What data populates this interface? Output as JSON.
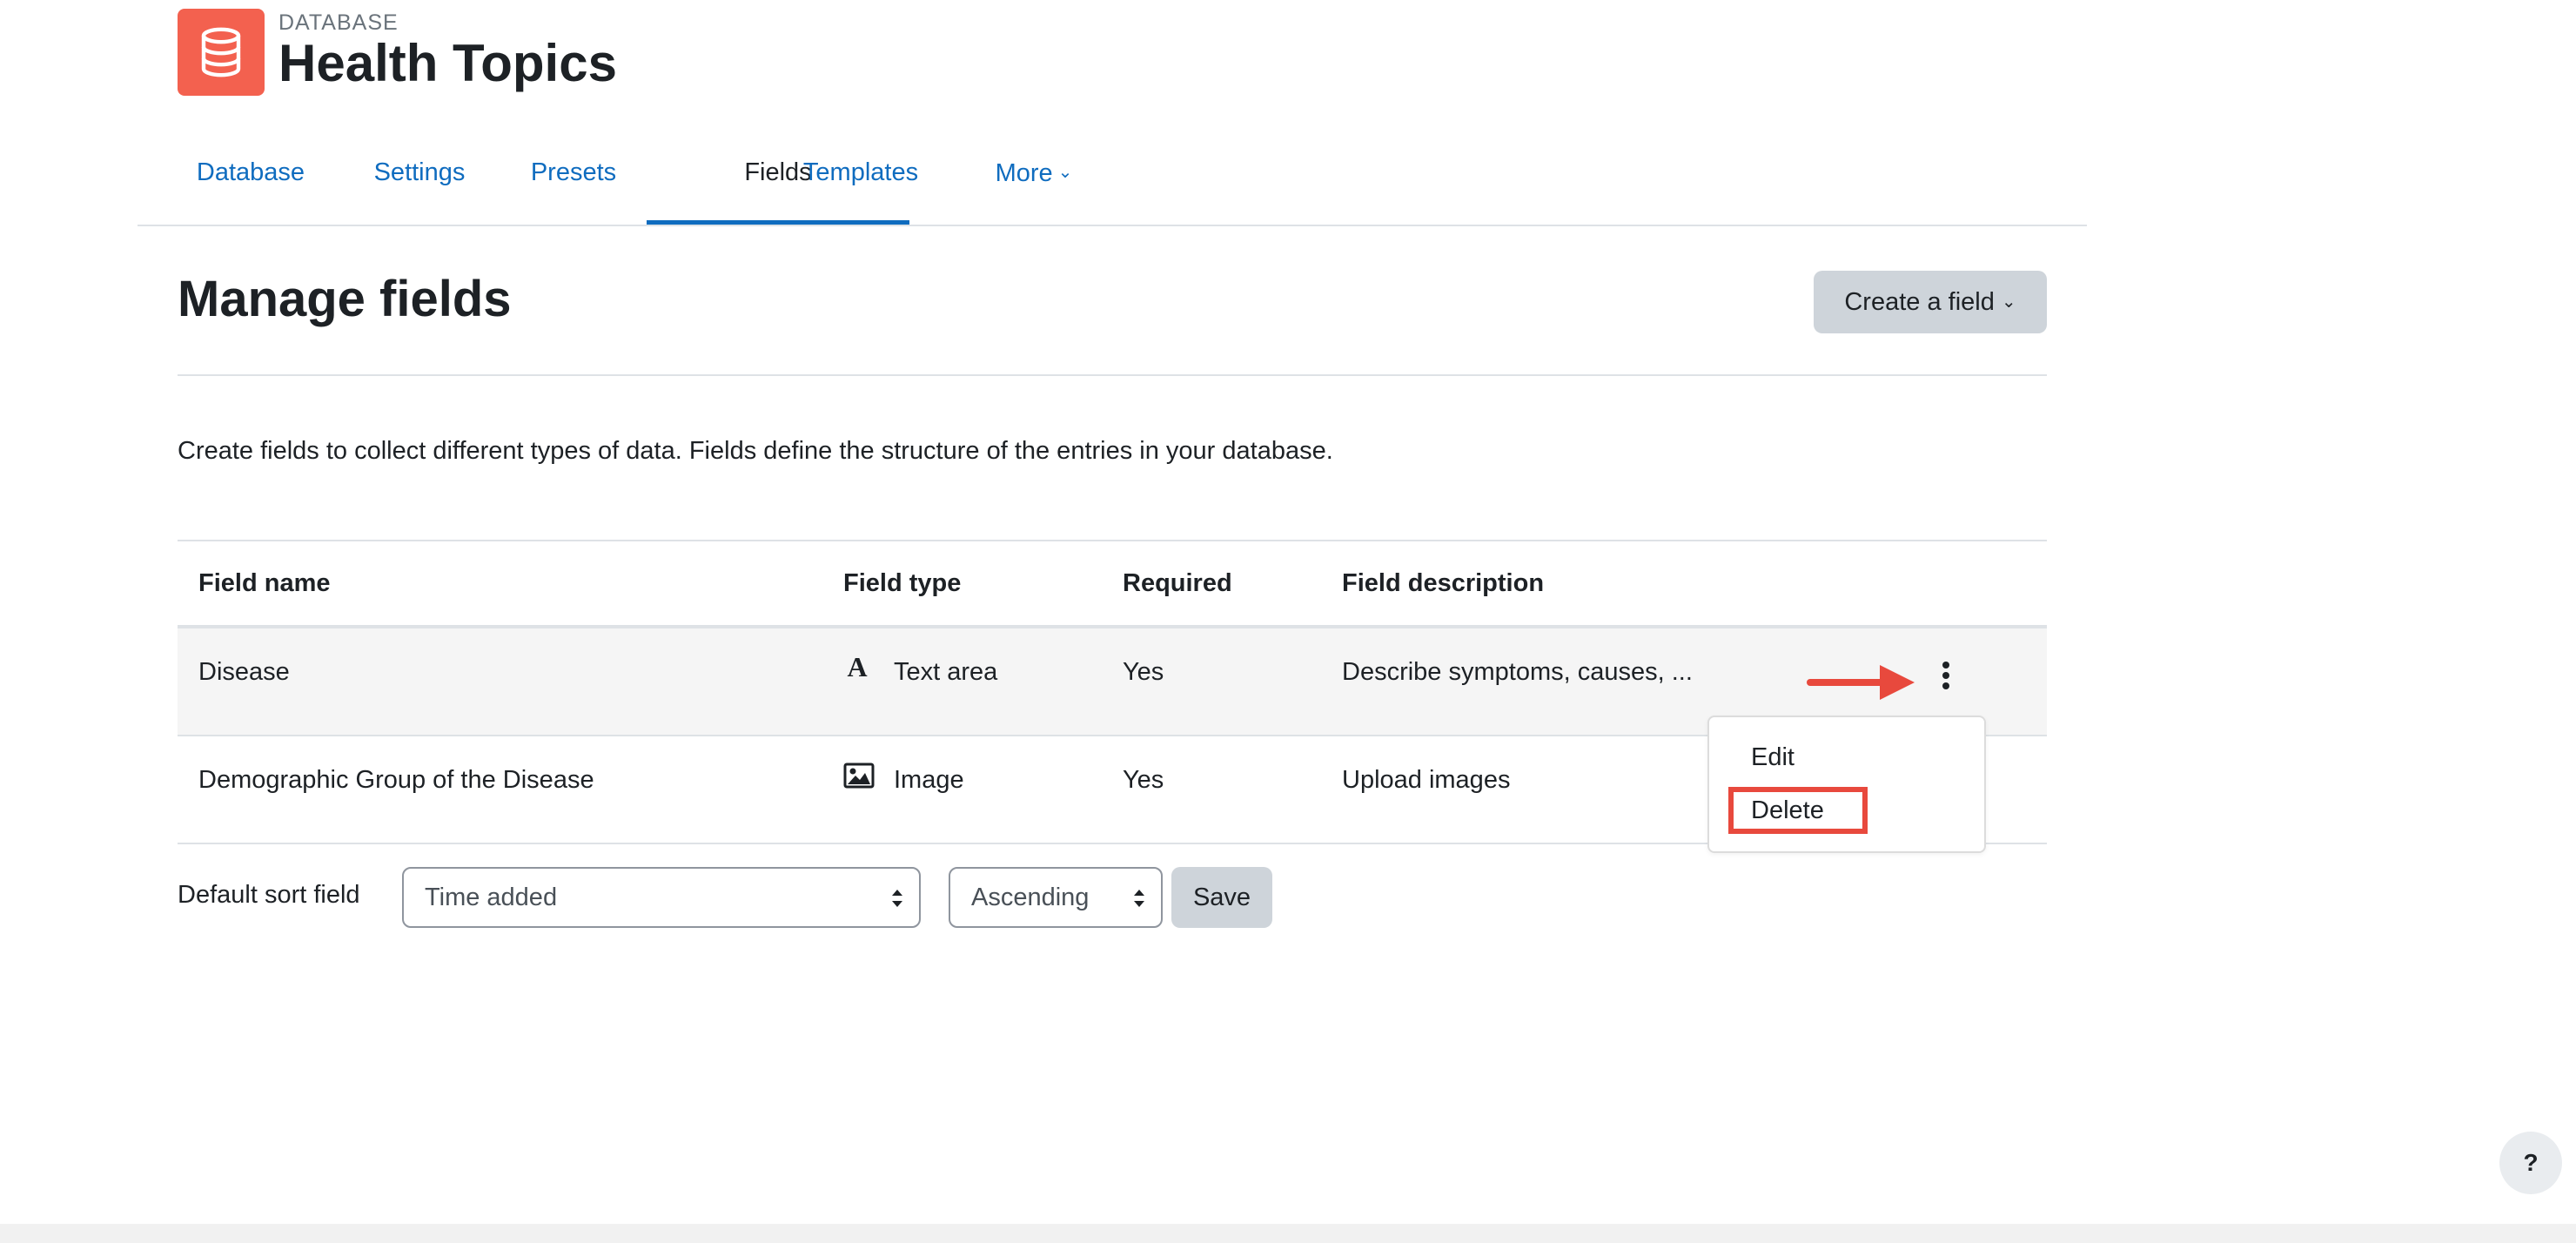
{
  "header": {
    "pre_title": "DATABASE",
    "title": "Health Topics",
    "icon": "database-icon",
    "icon_color": "#f3614f"
  },
  "nav": {
    "tabs": [
      {
        "label": "Database"
      },
      {
        "label": "Settings"
      },
      {
        "label": "Presets"
      },
      {
        "label": "Fields",
        "active": true
      },
      {
        "label": "Templates"
      },
      {
        "label": "More"
      }
    ]
  },
  "main": {
    "heading": "Manage fields",
    "create_button": "Create a field",
    "intro": "Create fields to collect different types of data. Fields define the structure of the entries in your database."
  },
  "table": {
    "columns": [
      "Field name",
      "Field type",
      "Required",
      "Field description"
    ],
    "rows": [
      {
        "name": "Disease",
        "type": "Text area",
        "type_icon": "text-area-icon",
        "required": "Yes",
        "description": "Describe symptoms, causes, ..."
      },
      {
        "name": "Demographic Group of the Disease",
        "type": "Image",
        "type_icon": "image-icon",
        "required": "Yes",
        "description": "Upload images"
      }
    ]
  },
  "actions_menu": {
    "items": [
      "Edit",
      "Delete"
    ],
    "highlighted": "Delete",
    "highlight_color": "#e8493d"
  },
  "sort": {
    "label": "Default sort field",
    "field_value": "Time added",
    "order_value": "Ascending",
    "save_label": "Save"
  },
  "help": {
    "label": "?"
  },
  "colors": {
    "link": "#0f6cbf",
    "button_secondary": "#ced4da",
    "annotation_arrow": "#e8493d"
  }
}
